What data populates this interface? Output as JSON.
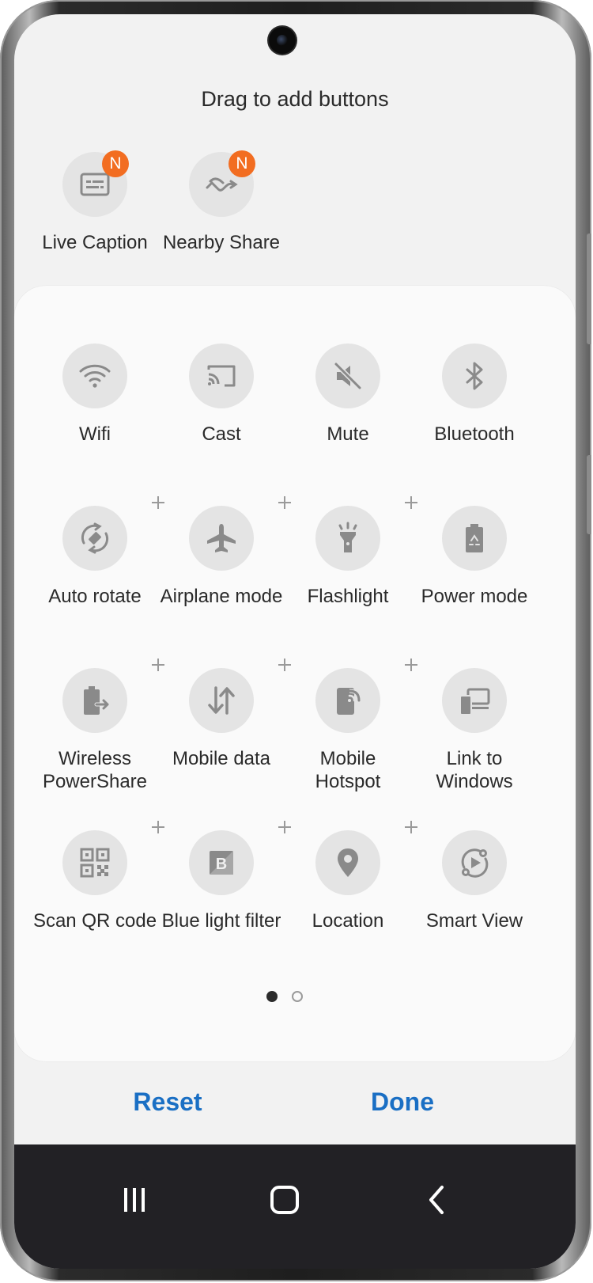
{
  "header": {
    "title": "Drag to add buttons"
  },
  "available": [
    {
      "label": "Live Caption",
      "badge": "N",
      "icon": "live-caption-icon"
    },
    {
      "label": "Nearby Share",
      "badge": "N",
      "icon": "nearby-share-icon"
    }
  ],
  "active": [
    {
      "label": "Wifi",
      "icon": "wifi-icon"
    },
    {
      "label": "Cast",
      "icon": "cast-icon"
    },
    {
      "label": "Mute",
      "icon": "mute-icon"
    },
    {
      "label": "Bluetooth",
      "icon": "bluetooth-icon"
    },
    {
      "label": "Auto rotate",
      "icon": "auto-rotate-icon"
    },
    {
      "label": "Airplane mode",
      "icon": "airplane-icon"
    },
    {
      "label": "Flashlight",
      "icon": "flashlight-icon"
    },
    {
      "label": "Power mode",
      "icon": "power-mode-icon"
    },
    {
      "label": "Wireless PowerShare",
      "icon": "wireless-powershare-icon"
    },
    {
      "label": "Mobile data",
      "icon": "mobile-data-icon"
    },
    {
      "label": "Mobile Hotspot",
      "icon": "mobile-hotspot-icon"
    },
    {
      "label": "Link to Windows",
      "icon": "link-to-windows-icon"
    },
    {
      "label": "Scan QR code",
      "icon": "qr-code-icon"
    },
    {
      "label": "Blue light filter",
      "icon": "blue-light-filter-icon"
    },
    {
      "label": "Location",
      "icon": "location-icon"
    },
    {
      "label": "Smart View",
      "icon": "smart-view-icon"
    }
  ],
  "pager": {
    "pages": 2,
    "current": 1
  },
  "actions": {
    "reset": "Reset",
    "done": "Done"
  },
  "colors": {
    "accent": "#1a6fc4",
    "badge": "#f26d21",
    "icon": "#8a8a8a",
    "tile_bg": "#e4e4e4"
  }
}
